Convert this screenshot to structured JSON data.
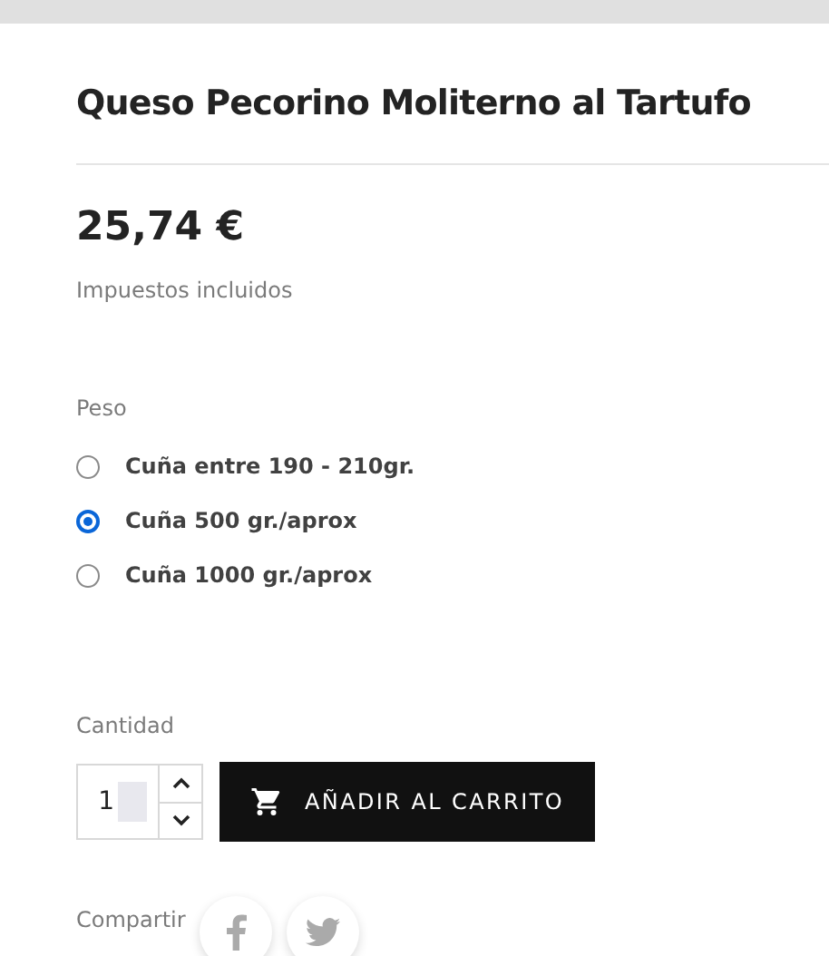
{
  "product": {
    "title": "Queso Pecorino Moliterno al Tartufo",
    "price": "25,74 €",
    "tax_note": "Impuestos incluidos"
  },
  "weight": {
    "label": "Peso",
    "options": [
      {
        "label": "Cuña entre 190 - 210gr.",
        "selected": false
      },
      {
        "label": "Cuña 500 gr./aprox",
        "selected": true
      },
      {
        "label": "Cuña 1000 gr./aprox",
        "selected": false
      }
    ]
  },
  "quantity": {
    "label": "Cantidad",
    "value": "1"
  },
  "add_to_cart": {
    "label": "AÑADIR AL CARRITO"
  },
  "share": {
    "label": "Compartir"
  }
}
